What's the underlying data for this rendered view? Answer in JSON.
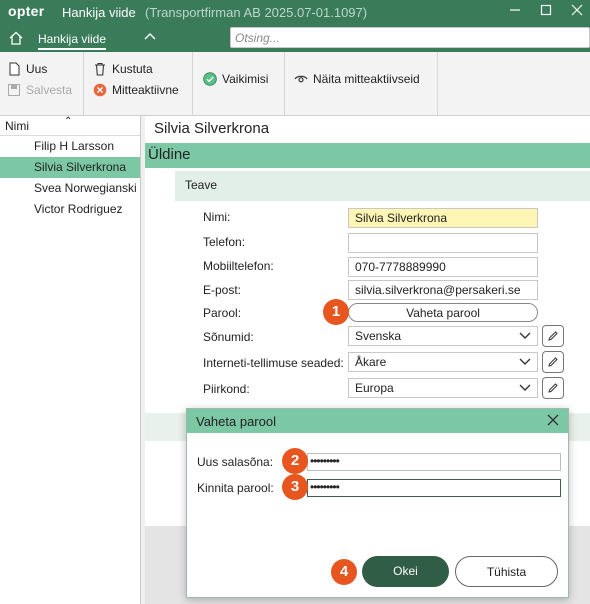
{
  "titlebar": {
    "logo": "opter",
    "title": "Hankija viide",
    "subtitle": "(Transportfirman AB 2025.07-01.1097)"
  },
  "navbar": {
    "tab": "Hankija viide",
    "search_placeholder": "Otsing..."
  },
  "toolbar": {
    "new_label": "Uus",
    "save_label": "Salvesta",
    "delete_label": "Kustuta",
    "inactive_label": "Mitteaktiivne",
    "default_label": "Vaikimisi",
    "show_inactive_label": "Näita mitteaktiivseid"
  },
  "sidebar": {
    "header": "Nimi",
    "items": [
      {
        "label": "Filip H Larsson",
        "selected": false
      },
      {
        "label": "Silvia Silverkrona",
        "selected": true
      },
      {
        "label": "Svea Norwegianski",
        "selected": false
      },
      {
        "label": "Victor Rodriguez",
        "selected": false
      }
    ]
  },
  "main": {
    "title": "Silvia Silverkrona",
    "section": "Üldine",
    "subsection": "Teave",
    "labels": {
      "name": "Nimi:",
      "phone": "Telefon:",
      "mobile": "Mobiiltelefon:",
      "email": "E-post:",
      "password": "Parool:",
      "messages": "Sõnumid:",
      "order_settings": "Interneti-tellimuse seaded:",
      "region": "Piirkond:"
    },
    "values": {
      "name": "Silvia Silverkrona",
      "phone": "",
      "mobile": "070-7778889990",
      "email": "silvia.silverkrona@persakeri.se",
      "messages": "Svenska",
      "order_settings": "Åkare",
      "region": "Europa"
    },
    "change_password_label": "Vaheta parool"
  },
  "dialog": {
    "title": "Vaheta parool",
    "new_password_label": "Uus salasõna:",
    "confirm_password_label": "Kinnita parool:",
    "new_password_value": "•••••••••",
    "confirm_password_value": "•••••••••",
    "ok_label": "Okei",
    "cancel_label": "Tühista"
  },
  "badges": [
    "1",
    "2",
    "3",
    "4"
  ],
  "colors": {
    "brand": "#3a7b5a",
    "accent": "#7cc8a4",
    "badge": "#e8561f",
    "ok_button": "#2f5d46"
  }
}
